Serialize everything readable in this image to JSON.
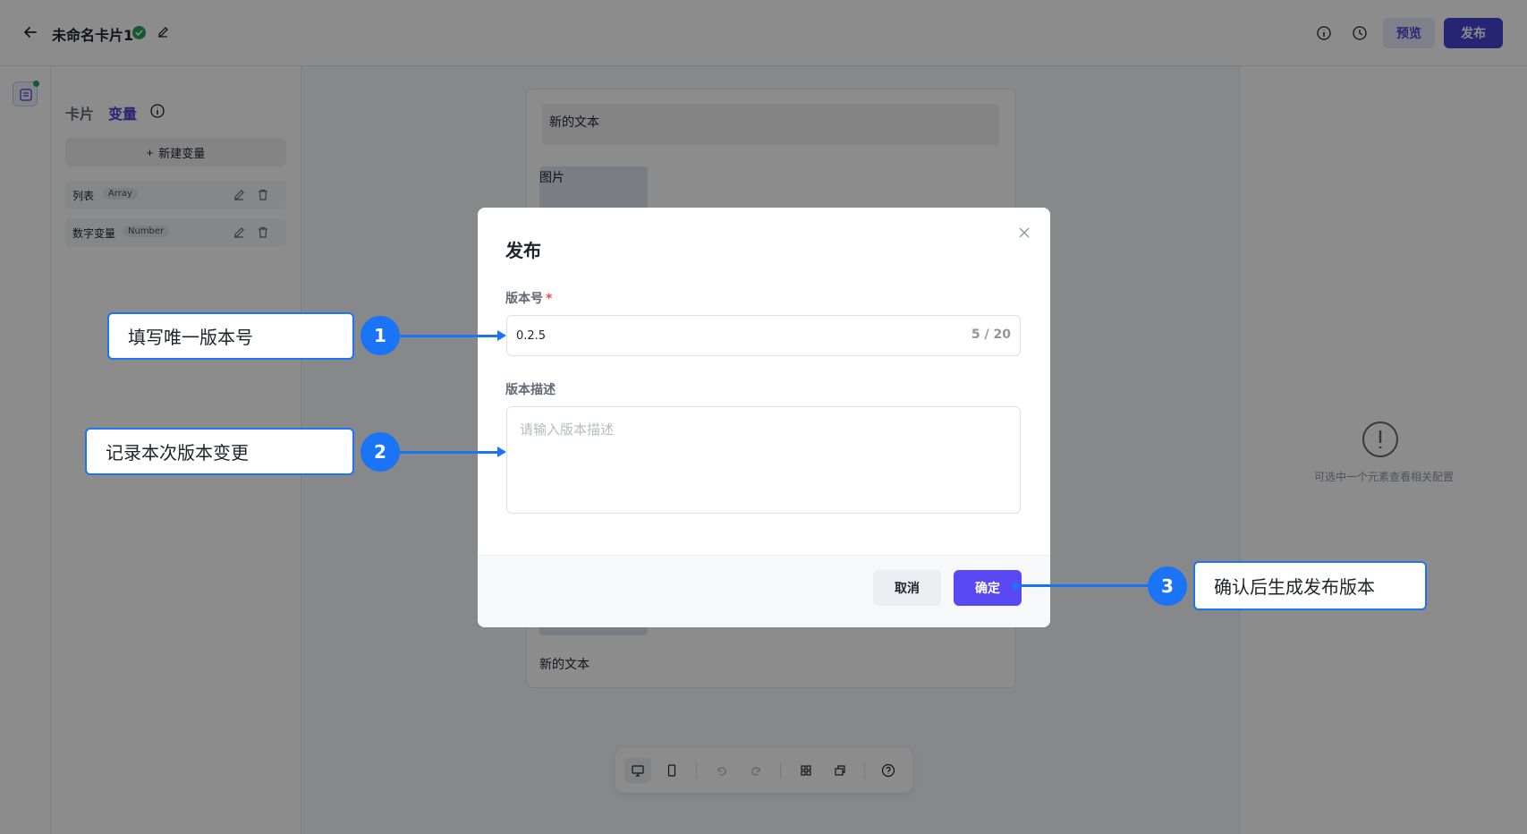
{
  "header": {
    "title": "未命名卡片1",
    "preview_label": "预览",
    "publish_label": "发布"
  },
  "side_panel": {
    "tab_card": "卡片",
    "tab_variable": "变量",
    "new_variable_label": "新建变量",
    "variables": [
      {
        "name": "列表",
        "type": "Array"
      },
      {
        "name": "数字变量",
        "type": "Number"
      }
    ]
  },
  "canvas": {
    "text_top": "新的文本",
    "image_alt": "图片",
    "text_bottom": "新的文本"
  },
  "right_panel": {
    "empty_hint": "可选中一个元素查看相关配置"
  },
  "modal": {
    "title": "发布",
    "version_label": "版本号",
    "required_mark": "*",
    "version_value": "0.2.5",
    "version_count": "5 / 20",
    "description_label": "版本描述",
    "description_placeholder": "请输入版本描述",
    "cancel_label": "取消",
    "confirm_label": "确定"
  },
  "annotations": [
    {
      "number": "1",
      "text": "填写唯一版本号"
    },
    {
      "number": "2",
      "text": "记录本次版本变更"
    },
    {
      "number": "3",
      "text": "确认后生成发布版本"
    }
  ],
  "colors": {
    "primary": "#4742d4",
    "confirm": "#5a48f2",
    "annotation": "#1a74f5",
    "success": "#22a55b"
  }
}
